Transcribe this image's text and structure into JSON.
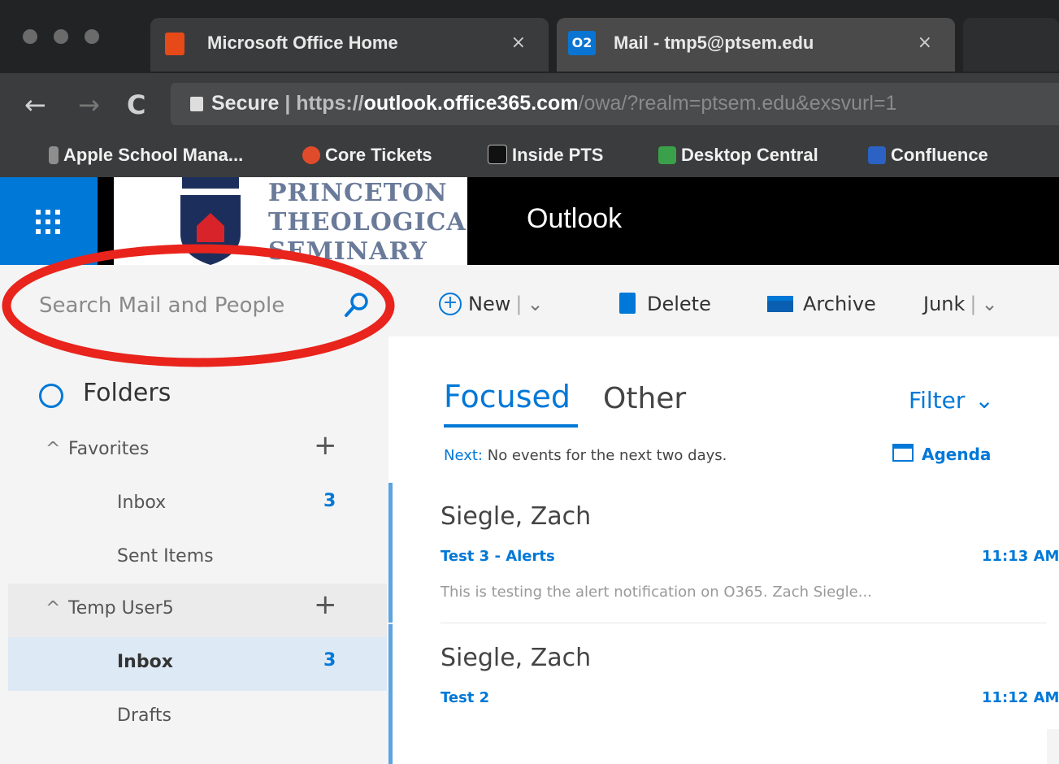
{
  "browser": {
    "tabs": [
      {
        "title": "Microsoft Office Home",
        "close": "×"
      },
      {
        "title": "Mail - tmp5@ptsem.edu",
        "close": "×",
        "icon_text": "O2"
      }
    ],
    "nav": {
      "back": "←",
      "forward": "→",
      "reload": "C"
    },
    "url": {
      "secure_label": "Secure",
      "separator": " | ",
      "scheme": "https://",
      "host": "outlook.office365.com",
      "path": "/owa/?realm=ptsem.edu&exsvurl=1"
    },
    "bookmarks": [
      {
        "label": "Apple School Mana...",
        "color": "#8e8e8e"
      },
      {
        "label": "Core Tickets",
        "color": "#e04b2c"
      },
      {
        "label": "Inside PTS",
        "color": "#111111"
      },
      {
        "label": "Desktop Central",
        "color": "#3aa04a"
      },
      {
        "label": "Confluence",
        "color": "#2b62c4"
      }
    ]
  },
  "office_header": {
    "logo_lines": [
      "PRINCETON",
      "THEOLOGICAL",
      "SEMINARY"
    ],
    "app_title": "Outlook",
    "waffle_color": "#0078d7"
  },
  "left_pane": {
    "search_placeholder": "Search Mail and People",
    "folders_title": "Folders",
    "sections": [
      {
        "name": "Favorites",
        "caret": "^",
        "plus": "+"
      },
      {
        "name": "Temp User5",
        "caret": "^",
        "plus": "+"
      }
    ],
    "favorites": [
      {
        "label": "Inbox",
        "count": "3"
      },
      {
        "label": "Sent Items",
        "count": ""
      }
    ],
    "user_folders": [
      {
        "label": "Inbox",
        "count": "3"
      },
      {
        "label": "Drafts",
        "count": ""
      }
    ]
  },
  "command_bar": {
    "new_label": "New",
    "delete_label": "Delete",
    "archive_label": "Archive",
    "junk_label": "Junk",
    "separator": "|",
    "chevron": "⌄"
  },
  "inbox": {
    "focused_tab": "Focused",
    "other_tab": "Other",
    "filter_label": "Filter",
    "next_label": "Next:",
    "next_text": "No events for the next two days.",
    "agenda_label": "Agenda",
    "messages": [
      {
        "sender": "Siegle, Zach",
        "subject": "Test 3 - Alerts",
        "time": "11:13 AM",
        "preview": "This is testing the alert notification on O365. Zach Siegle..."
      },
      {
        "sender": "Siegle, Zach",
        "subject": "Test 2",
        "time": "11:12 AM",
        "preview": ""
      }
    ]
  },
  "colors": {
    "accent": "#0078d7",
    "annotation_red": "#e8241c"
  }
}
